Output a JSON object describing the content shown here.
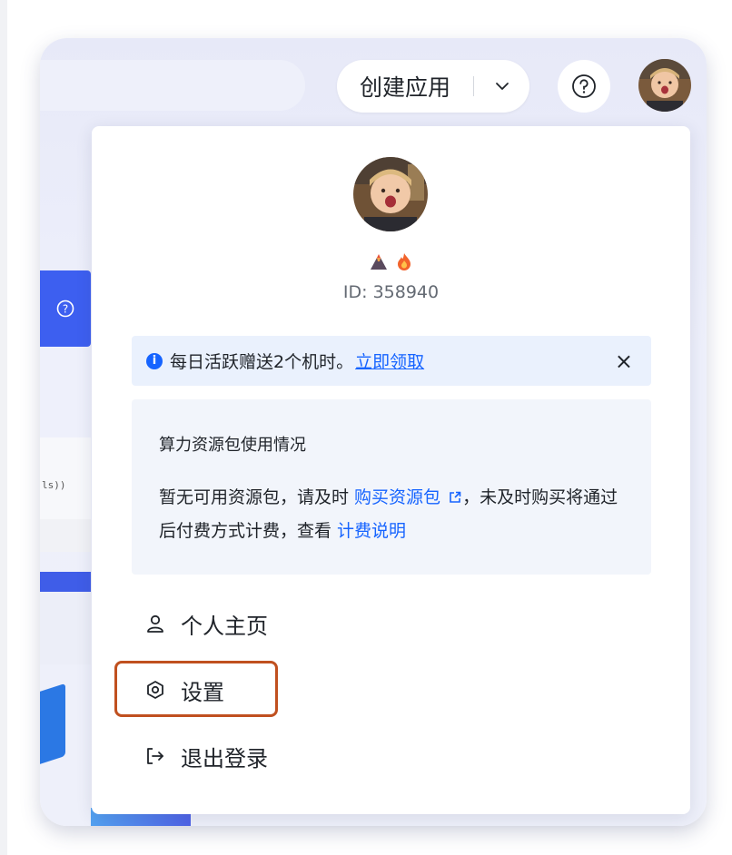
{
  "header": {
    "create_app_label": "创建应用"
  },
  "background": {
    "code_fragment": "ls))"
  },
  "user_menu": {
    "user_id": "ID: 358940",
    "badges": [
      "volcano-badge",
      "fire-badge"
    ],
    "notice": {
      "text": "每日活跃赠送2个机时。",
      "link": "立即领取",
      "close": "×"
    },
    "quota": {
      "title": "算力资源包使用情况",
      "body_part1": "暂无可用资源包，请及时 ",
      "buy_link": "购买资源包",
      "body_part2": "，未及时购买将通过后付费方式计费，查看 ",
      "billing_link": "计费说明"
    },
    "items": [
      {
        "label": "个人主页",
        "icon": "user-icon"
      },
      {
        "label": "设置",
        "icon": "settings-icon"
      },
      {
        "label": "退出登录",
        "icon": "logout-icon"
      }
    ]
  },
  "colors": {
    "accent": "#1664ff",
    "highlight_border": "#c0501f",
    "notice_bg": "#eaf1fd"
  }
}
